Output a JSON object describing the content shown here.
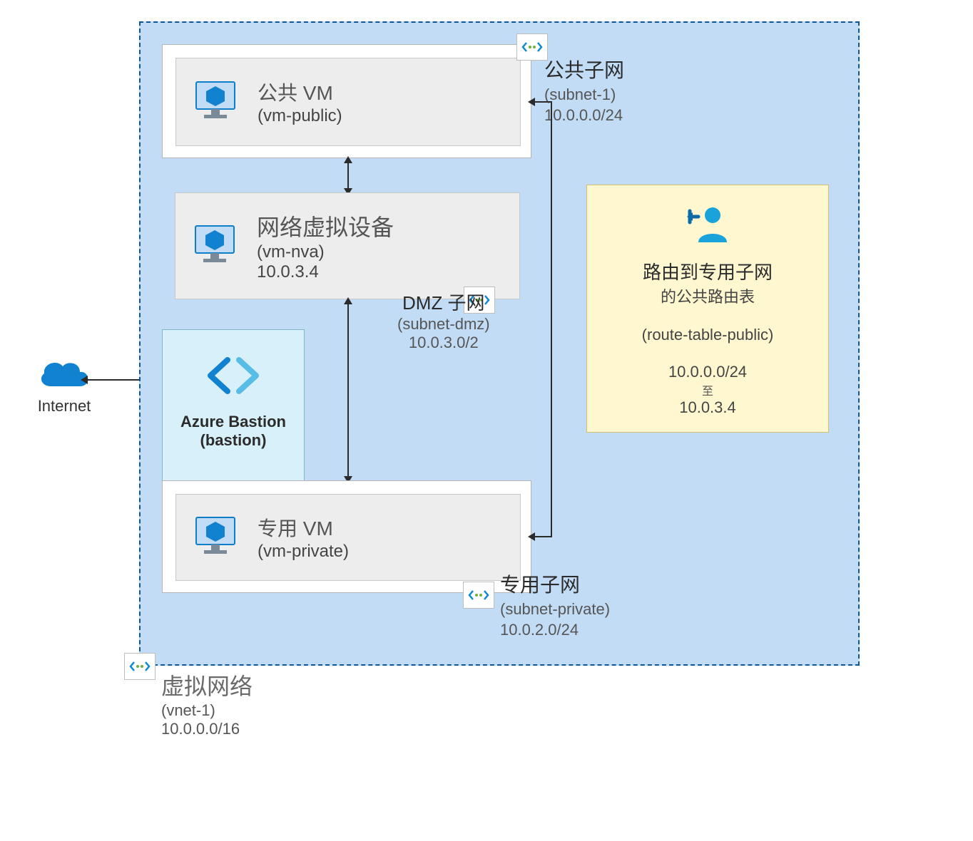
{
  "internet": {
    "label": "Internet"
  },
  "vnet": {
    "title": "虚拟网络",
    "name": "(vnet-1)",
    "cidr": "10.0.0.0/16"
  },
  "subnet_public": {
    "title": "公共子网",
    "name": "(subnet-1)",
    "cidr": "10.0.0.0/24"
  },
  "subnet_dmz": {
    "title": "DMZ 子网",
    "name": "(subnet-dmz)",
    "cidr": "10.0.3.0/2"
  },
  "subnet_private": {
    "title": "专用子网",
    "name": "(subnet-private)",
    "cidr": "10.0.2.0/24"
  },
  "vm_public": {
    "title": "公共 VM",
    "name": "(vm-public)"
  },
  "vm_nva": {
    "title": "网络虚拟设备",
    "name": "(vm-nva)",
    "ip": "10.0.3.4"
  },
  "vm_private": {
    "title": "专用 VM",
    "name": "(vm-private)"
  },
  "bastion": {
    "title": "Azure Bastion",
    "name": "(bastion)"
  },
  "route_table": {
    "title": "路由到专用子网",
    "sub1": "的公共路由表",
    "name": "(route-table-public)",
    "from": "10.0.0.0/24",
    "to_label": "至",
    "to": "10.0.3.4"
  },
  "colors": {
    "azure_blue": "#0f89d2",
    "vnet_bg": "#c3dcf6",
    "bastion_bg": "#d8f0f9",
    "route_bg": "#fff7d0"
  }
}
